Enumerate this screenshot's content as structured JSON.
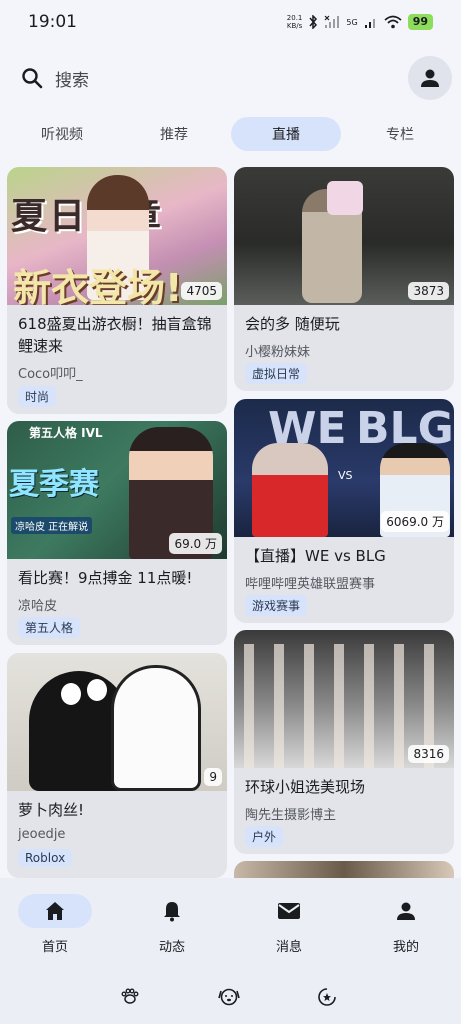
{
  "status_bar": {
    "time": "19:01",
    "net_speed_value": "20.1",
    "net_speed_unit": "KB/s",
    "signal_label": "5G",
    "battery": "99"
  },
  "search": {
    "placeholder": "搜索"
  },
  "tabs": [
    {
      "label": "听视频",
      "active": false
    },
    {
      "label": "推荐",
      "active": false
    },
    {
      "label": "直播",
      "active": true
    },
    {
      "label": "专栏",
      "active": false
    }
  ],
  "cards": [
    {
      "thumb_text_top": "夏日序章",
      "thumb_text_bottom": "新衣登场!",
      "viewers": "4705",
      "title": "618盛夏出游衣橱！抽盲盒锦鲤速来",
      "author": "Coco叩叩_",
      "tag": "时尚"
    },
    {
      "viewers": "3873",
      "title": "会的多 随便玩",
      "author": "小樱粉妹妹",
      "tag": "虚拟日常"
    },
    {
      "thumb_text_top": "夏季赛",
      "thumb_badge": "第五人格 IVL",
      "thumb_caption": "凉哈皮 正在解说",
      "viewers": "69.0 万",
      "title": "看比赛！9点搏金 11点暖!",
      "author": "凉哈皮",
      "tag": "第五人格"
    },
    {
      "thumb_team_left": "WE",
      "thumb_team_right": "BLG",
      "thumb_vs": "VS",
      "viewers": "6069.0 万",
      "title": "【直播】WE vs BLG",
      "author": "哔哩哔哩英雄联盟赛事",
      "tag": "游戏赛事"
    },
    {
      "viewers": "9",
      "title": "萝卜肉丝!",
      "author": "jeoedje",
      "tag": "Roblox"
    },
    {
      "viewers": "8316",
      "title": "环球小姐选美现场",
      "author": "陶先生摄影博主",
      "tag": "户外"
    }
  ],
  "bottom_nav": [
    {
      "label": "首页",
      "icon": "home-icon",
      "active": true
    },
    {
      "label": "动态",
      "icon": "bell-icon",
      "active": false
    },
    {
      "label": "消息",
      "icon": "mail-icon",
      "active": false
    },
    {
      "label": "我的",
      "icon": "person-icon",
      "active": false
    }
  ],
  "colors": {
    "background": "#f4f5fa",
    "active_tab": "#d6e3fb",
    "card": "#e2e4ea",
    "battery": "#8ddc5b"
  }
}
